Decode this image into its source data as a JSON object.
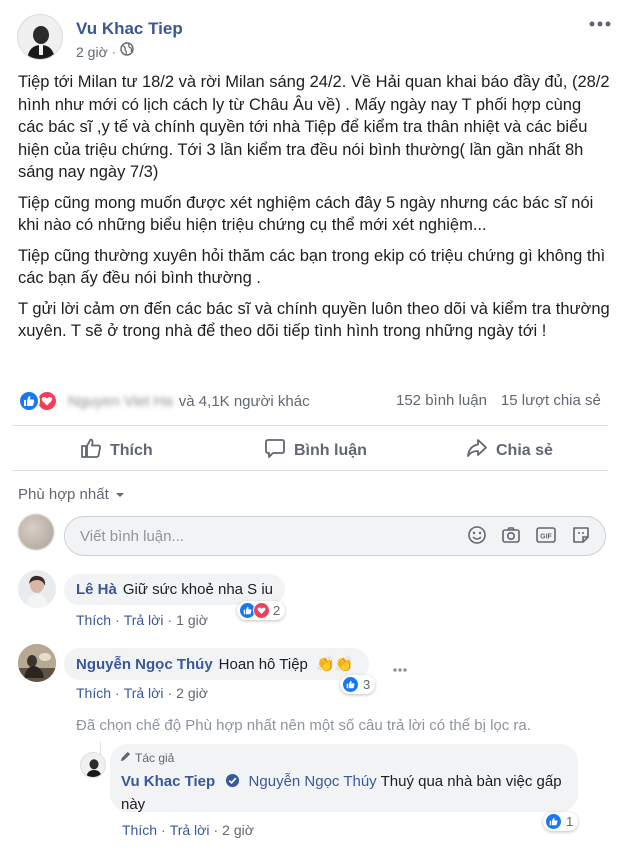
{
  "post": {
    "author": "Vu Khac Tiep",
    "time": "2 giờ",
    "paragraphs": [
      "Tiệp tới Milan tư 18/2 và rời Milan sáng 24/2. Về Hải quan khai báo đầy đủ, (28/2 hình như mới có lịch cách ly từ Châu Âu về) . Mấy ngày nay T phối hợp cùng các bác sĩ ,y tế và chính quyền tới nhà Tiệp để kiểm tra thân nhiệt và các biểu hiện của triệu chứng. Tới 3 lần kiểm tra đều nói bình thường( lần gần nhất 8h sáng nay ngày 7/3)",
      "Tiệp cũng mong muốn được xét nghiệm cách đây 5 ngày nhưng các bác sĩ nói khi nào có những biểu hiện triệu chứng cụ thể mới xét nghiệm...",
      "Tiệp cũng thường xuyên hỏi thăm các bạn trong ekip có triệu chứng gì không thì các bạn ấy đều nói bình thường .",
      "T gửi lời cảm ơn đến các bác sĩ và chính quyền luôn theo dõi và kiểm tra thường xuyên. T sẽ ở trong nhà để theo dõi tiếp tình hình trong những ngày tới !"
    ]
  },
  "stats": {
    "blurred_name": "Nguyen Viet Ha",
    "others": "và 4,1K người khác",
    "comments": "152 bình luận",
    "shares": "15 lượt chia sẻ"
  },
  "actions": {
    "like": "Thích",
    "comment": "Bình luận",
    "share": "Chia sẻ"
  },
  "sort": {
    "label": "Phù hợp nhất"
  },
  "composer": {
    "placeholder": "Viết bình luận..."
  },
  "comments": [
    {
      "name": "Lê Hà",
      "text": "Giữ sức khoẻ nha S iu",
      "like": "Thích",
      "reply": "Trả lời",
      "time": "1 giờ",
      "reactions": "2"
    },
    {
      "name": "Nguyễn Ngọc Thúy",
      "text": "Hoan hô Tiệp",
      "emoji": "👏👏",
      "like": "Thích",
      "reply": "Trả lời",
      "time": "2 giờ",
      "reactions": "3"
    }
  ],
  "filter_note": "Đã chọn chế độ Phù hợp nhất nên một số câu trả lời có thể bị lọc ra.",
  "reply": {
    "badge": "Tác giả",
    "name": "Vu Khac Tiep",
    "tag": "Nguyễn Ngọc Thúy",
    "text": "Thuý qua nhà bàn việc gấp này",
    "like": "Thích",
    "reply": "Trả lời",
    "time": "2 giờ",
    "reactions": "1"
  },
  "colors": {
    "link_blue": "#385898",
    "like_blue": "#1877f2",
    "love_red": "#f33e58",
    "bubble_bg": "#f2f3f5"
  }
}
